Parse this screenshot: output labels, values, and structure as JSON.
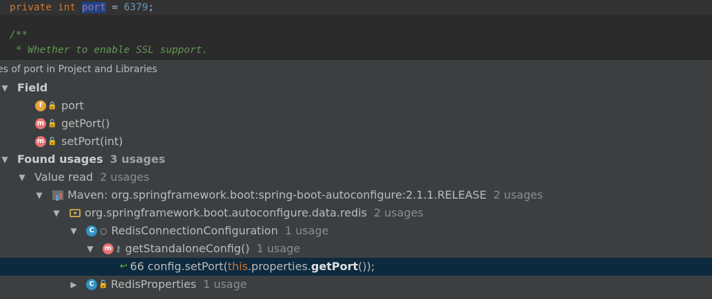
{
  "editor": {
    "line1": {
      "kw1": "private",
      "kw2": "int",
      "ident": "port",
      "op": " = ",
      "num": "6379",
      "end": ";"
    },
    "comment_open": "/**",
    "comment_text": " * Whether to enable SSL support."
  },
  "panel": {
    "header": "es of port in Project and Libraries"
  },
  "tree": {
    "field_label": "Field",
    "items": [
      {
        "icon": "f",
        "name": "port",
        "access": "private"
      },
      {
        "icon": "m",
        "name": "getPort()",
        "access": "public"
      },
      {
        "icon": "m",
        "name": "setPort(int)",
        "access": "public"
      }
    ],
    "found_label": "Found usages",
    "found_count": "3 usages",
    "value_read_label": "Value read",
    "value_read_count": "2 usages",
    "maven_label": "Maven: org.springframework.boot:spring-boot-autoconfigure:2.1.1.RELEASE",
    "maven_count": "2 usages",
    "package_label": "org.springframework.boot.autoconfigure.data.redis",
    "package_count": "2 usages",
    "class1_label": "RedisConnectionConfiguration",
    "class1_count": "1 usage",
    "method_label": "getStandaloneConfig()",
    "method_count": "1 usage",
    "usage_line": {
      "num": "66",
      "pre": "config.setPort(",
      "this": "this",
      ".": ".",
      "mid": "properties.",
      "bold": "getPort",
      "post": "());"
    },
    "class2_label": "RedisProperties",
    "class2_count": "1 usage"
  },
  "colors": {
    "selection": "#0d293e",
    "background": "#3c3f41",
    "editor_bg": "#2b2b2b"
  }
}
